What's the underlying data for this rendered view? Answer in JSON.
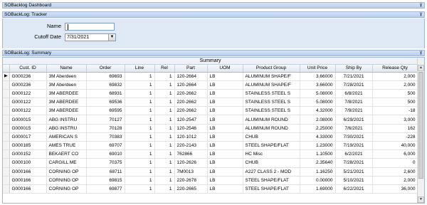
{
  "panels": {
    "dashboard_title": "SOBacklog Dashboard",
    "tracker_title": "SOBackLog: Tracker",
    "summary_title": "SOBackLog: Summary",
    "pin_glyph": "ɣ"
  },
  "tracker": {
    "name_label": "Name",
    "name_value": "",
    "cutoff_label": "Cutoff Date",
    "cutoff_value": "7/31/2021"
  },
  "summary": {
    "caption": "Summary",
    "columns": [
      "Cust. ID",
      "Name",
      "Order",
      "Line",
      "Rel",
      "Part",
      "UOM",
      "Product Group",
      "Unit Price",
      "Ship By",
      "Release Qty"
    ],
    "rows": [
      [
        "G000236",
        "3M Aberdeen",
        "69693",
        "1",
        "1",
        "120-2664",
        "LB",
        "ALUMINUM SHAPE/F",
        "3.66000",
        "7/21/2021",
        "2,000"
      ],
      [
        "G000236",
        "3M Aberdeen",
        "69832",
        "1",
        "1",
        "120-2664",
        "LB",
        "ALUMINUM SHAPE/F",
        "3.66000",
        "7/28/2021",
        "2,000"
      ],
      [
        "G000122",
        "3M ABERDEE",
        "68931",
        "1",
        "1",
        "220-2662",
        "LB",
        "STAINLESS STEEL S",
        "5.08000",
        "6/8/2021",
        "500"
      ],
      [
        "G000122",
        "3M ABERDEE",
        "69536",
        "1",
        "1",
        "220-2662",
        "LB",
        "STAINLESS STEEL S",
        "5.08000",
        "7/8/2021",
        "500"
      ],
      [
        "G000122",
        "3M ABERDEE",
        "69595",
        "1",
        "1",
        "220-2662",
        "LB",
        "STAINLESS STEEL S",
        "4.32000",
        "7/9/2021",
        "-18"
      ],
      [
        "G000015",
        "ABG INSTRU",
        "70127",
        "1",
        "1",
        "120-2547",
        "LB",
        "ALUMINUM ROUND",
        "2.08000",
        "6/29/2021",
        "3,000"
      ],
      [
        "G000015",
        "ABG INSTRU",
        "70128",
        "1",
        "1",
        "120-2546",
        "LB",
        "ALUMINUM ROUND",
        "2.25000",
        "7/6/2021",
        "162"
      ],
      [
        "G000017",
        "AMERICAN S",
        "70383",
        "1",
        "1",
        "120-1012",
        "LB",
        "CHUB",
        "4.33000",
        "7/30/2021",
        "-228"
      ],
      [
        "G000185",
        "AMES TRUE",
        "69707",
        "1",
        "1",
        "220-2143",
        "LB",
        "STEEL SHAPE/FLAT",
        "1.23000",
        "7/19/2021",
        "40,000"
      ],
      [
        "G000152",
        "BEKAERT CO",
        "69010",
        "1",
        "1",
        "762866",
        "LB",
        "HC Misc",
        "1.10500",
        "6/2/2021",
        "6,000"
      ],
      [
        "G000100",
        "CARGILL ME",
        "70375",
        "1",
        "1",
        "120-2626",
        "LB",
        "CHUB",
        "2.35640",
        "7/28/2021",
        "0"
      ],
      [
        "G000166",
        "CORNING OP",
        "68711",
        "1",
        "1",
        "7M0013",
        "LB",
        "A227 CLASS 2 - MOD",
        "1.16250",
        "5/21/2021",
        "2,600"
      ],
      [
        "G000166",
        "CORNING OP",
        "69815",
        "1",
        "1",
        "220-2678",
        "LB",
        "STEEL SHAPE/FLAT",
        "0.00000",
        "5/10/2021",
        "2,000"
      ],
      [
        "G000166",
        "CORNING OP",
        "69877",
        "1",
        "1",
        "220-2665",
        "LB",
        "STEEL SHAPE/FLAT",
        "1.69000",
        "6/22/2021",
        "36,000"
      ]
    ],
    "current_row_glyph": "▶"
  },
  "scrollbar": {
    "up_glyph": "▲",
    "down_glyph": "▼"
  }
}
